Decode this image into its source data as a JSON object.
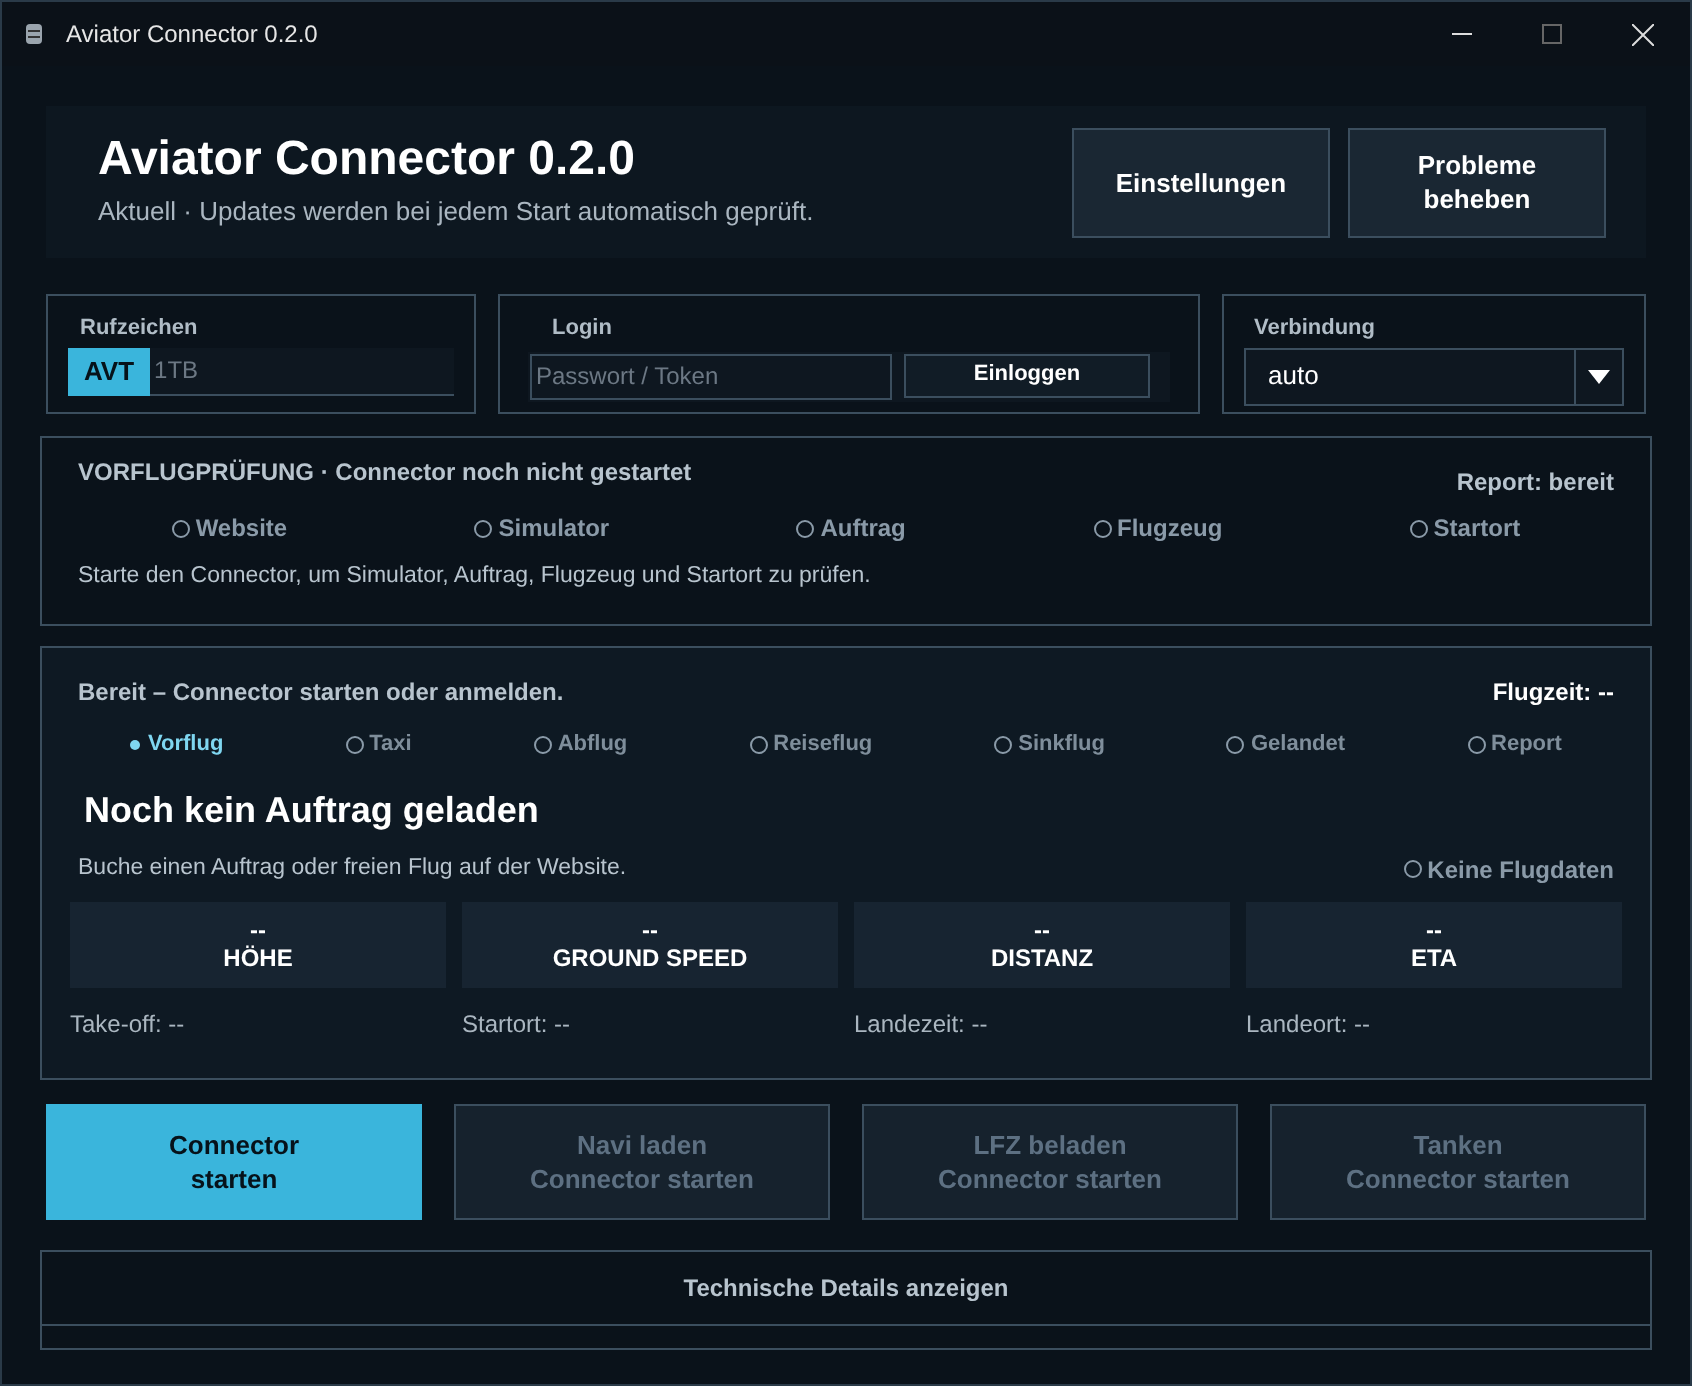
{
  "window": {
    "title": "Aviator Connector 0.2.0"
  },
  "header": {
    "title": "Aviator Connector 0.2.0",
    "subtitle": "Aktuell · Updates werden bei jedem Start automatisch geprüft.",
    "buttons": [
      "Einstellungen",
      "Probleme beheben"
    ]
  },
  "callsign": {
    "label": "Rufzeichen",
    "prefix": "AVT",
    "placeholder": "1TB"
  },
  "login": {
    "label": "Login",
    "placeholder": "Passwort / Token",
    "button": "Einloggen"
  },
  "connection": {
    "label": "Verbindung",
    "value": "auto"
  },
  "preflight": {
    "title": "VORFLUGPRÜFUNG · Connector noch nicht gestartet",
    "report": "Report: bereit",
    "checks": [
      {
        "label": "Website",
        "done": false
      },
      {
        "label": "Simulator",
        "done": false
      },
      {
        "label": "Auftrag",
        "done": false
      },
      {
        "label": "Flugzeug",
        "done": false
      },
      {
        "label": "Startort",
        "done": false
      }
    ],
    "note": "Starte den Connector, um Simulator, Auftrag, Flugzeug und Startort zu prüfen."
  },
  "flight": {
    "status": "Bereit – Connector starten oder anmelden.",
    "flight_time": "Flugzeit: --",
    "phases": [
      {
        "label": "Vorflug",
        "selected": true
      },
      {
        "label": "Taxi",
        "selected": false
      },
      {
        "label": "Abflug",
        "selected": false
      },
      {
        "label": "Reiseflug",
        "selected": false
      },
      {
        "label": "Sinkflug",
        "selected": false
      },
      {
        "label": "Gelandet",
        "selected": false
      },
      {
        "label": "Report",
        "selected": false
      }
    ],
    "heading": "Noch kein Auftrag geladen",
    "hint": "Buche einen Auftrag oder freien Flug auf der Website.",
    "data_status": {
      "label": "Keine Flugdaten",
      "active": false
    },
    "metrics": [
      {
        "value": "--",
        "label": "HÖHE"
      },
      {
        "value": "--",
        "label": "GROUND SPEED"
      },
      {
        "value": "--",
        "label": "DISTANZ"
      },
      {
        "value": "--",
        "label": "ETA"
      }
    ],
    "footer": [
      "Take-off: --",
      "Startort: --",
      "Landezeit: --",
      "Landeort: --"
    ]
  },
  "actions": [
    {
      "label": "Connector",
      "sublabel": "starten",
      "disabled": false
    },
    {
      "label": "Navi laden",
      "sublabel": "Connector starten",
      "disabled": true
    },
    {
      "label": "LFZ beladen",
      "sublabel": "Connector starten",
      "disabled": true
    },
    {
      "label": "Tanken",
      "sublabel": "Connector starten",
      "disabled": true
    }
  ],
  "details_button": "Technische Details anzeigen"
}
